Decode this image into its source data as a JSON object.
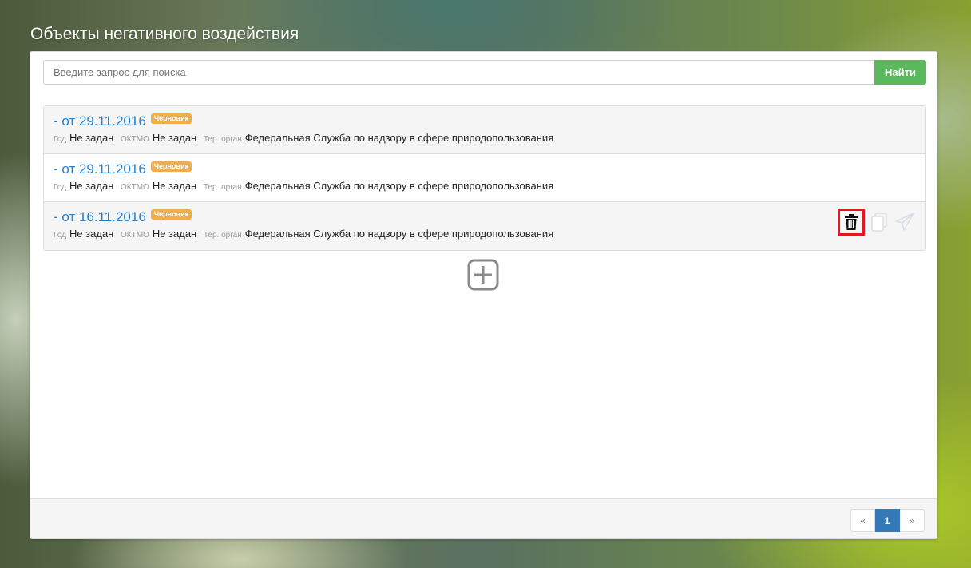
{
  "page": {
    "title": "Объекты негативного воздействия"
  },
  "search": {
    "placeholder": "Введите запрос для поиска",
    "button_label": "Найти"
  },
  "items": [
    {
      "title": "- от 29.11.2016",
      "badge": "Черновик",
      "year_label": "Год",
      "year_value": "Не задан",
      "oktmo_label": "ОКТМО",
      "oktmo_value": "Не задан",
      "org_label": "Тер. орган",
      "org_value": "Федеральная Служба по надзору в сфере природопользования"
    },
    {
      "title": "- от 29.11.2016",
      "badge": "Черновик",
      "year_label": "Год",
      "year_value": "Не задан",
      "oktmo_label": "ОКТМО",
      "oktmo_value": "Не задан",
      "org_label": "Тер. орган",
      "org_value": "Федеральная Служба по надзору в сфере природопользования"
    },
    {
      "title": "- от 16.11.2016",
      "badge": "Черновик",
      "year_label": "Год",
      "year_value": "Не задан",
      "oktmo_label": "ОКТМО",
      "oktmo_value": "Не задан",
      "org_label": "Тер. орган",
      "org_value": "Федеральная Служба по надзору в сфере природопользования",
      "actions": [
        "trash-icon",
        "copy-icon",
        "send-icon"
      ]
    }
  ],
  "add_button": {
    "icon": "plus-square-icon"
  },
  "pagination": {
    "prev": "«",
    "current": "1",
    "next": "»"
  },
  "colors": {
    "link": "#2a7fc4",
    "badge": "#f0ad4e",
    "search_button": "#5cb85c",
    "active_page": "#337ab7",
    "highlight": "#e4161f"
  }
}
